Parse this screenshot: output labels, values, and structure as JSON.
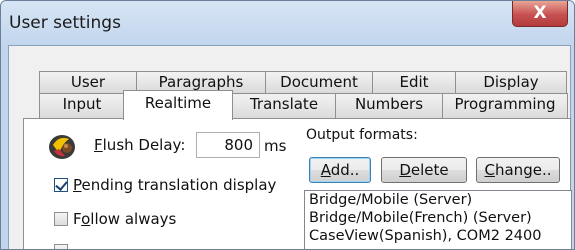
{
  "window": {
    "title": "User settings",
    "close_glyph": "X"
  },
  "tabs_back": [
    "User",
    "Paragraphs",
    "Document",
    "Edit",
    "Display"
  ],
  "tabs_front": [
    "Input",
    "Realtime",
    "Translate",
    "Numbers",
    "Programming"
  ],
  "active_tab": "Realtime",
  "realtime": {
    "flush_delay_label_prefix": "",
    "flush_delay_label_accel": "F",
    "flush_delay_label_rest": "lush Delay:",
    "flush_delay_value": "800",
    "flush_delay_unit": "ms",
    "pending_accel": "P",
    "pending_rest": "ending translation display",
    "pending_checked": true,
    "follow_prefix": "F",
    "follow_accel": "o",
    "follow_rest": "llow always",
    "follow_checked": false,
    "fourth_option_checked": false,
    "output_formats_label": "Output formats:",
    "add_label_accel": "A",
    "add_label_rest": "dd..",
    "delete_label_accel": "D",
    "delete_label_rest": "elete",
    "change_label_accel": "C",
    "change_label_rest": "hange..",
    "output_formats": [
      "Bridge/Mobile (Server)",
      "Bridge/Mobile(French) (Server)",
      "CaseView(Spanish), COM2 2400"
    ]
  },
  "icons": {
    "flush": "stenograph-icon",
    "close": "close-icon"
  },
  "colors": {
    "close_button": "#c75050",
    "frame": "#c2d5ec",
    "client": "#f0f0f0"
  }
}
